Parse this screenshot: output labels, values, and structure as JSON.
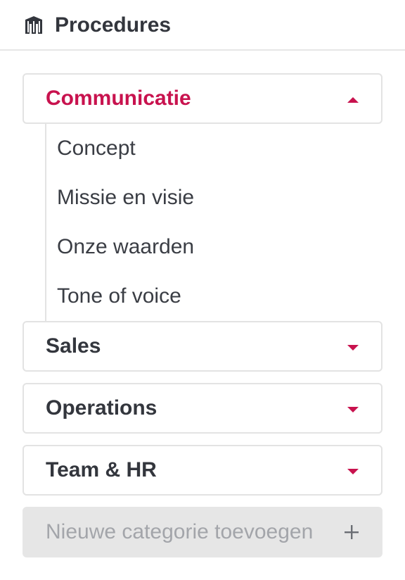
{
  "header": {
    "title": "Procedures",
    "icon": "building-icon"
  },
  "categories": [
    {
      "label": "Communicatie",
      "expanded": true,
      "items": [
        "Concept",
        "Missie en visie",
        "Onze waarden",
        "Tone of voice"
      ]
    },
    {
      "label": "Sales",
      "expanded": false
    },
    {
      "label": "Operations",
      "expanded": false
    },
    {
      "label": "Team & HR",
      "expanded": false
    }
  ],
  "add_category": {
    "label": "Nieuwe categorie toevoegen",
    "icon": "plus-icon"
  },
  "colors": {
    "accent": "#c8124e",
    "text": "#33363d",
    "border": "#e3e3e3",
    "disabled_bg": "#e6e6e6",
    "disabled_text": "#a3a5aa"
  }
}
